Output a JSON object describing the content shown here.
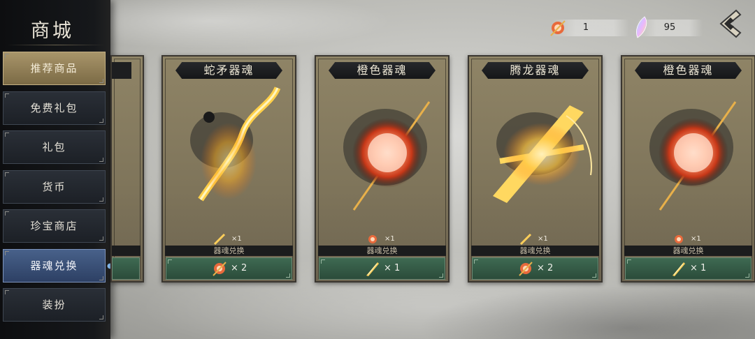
{
  "sidebar": {
    "title": "商城",
    "items": [
      {
        "label": "推荐商品",
        "state": "active-gold"
      },
      {
        "label": "免费礼包",
        "state": ""
      },
      {
        "label": "礼包",
        "state": ""
      },
      {
        "label": "货币",
        "state": ""
      },
      {
        "label": "珍宝商店",
        "state": ""
      },
      {
        "label": "器魂兑换",
        "state": "active-blue"
      },
      {
        "label": "装扮",
        "state": ""
      }
    ]
  },
  "currencies": [
    {
      "icon": "soul-orb-icon",
      "value": "1"
    },
    {
      "icon": "crystal-feather-icon",
      "value": "95"
    }
  ],
  "back_icon": "back-arrow-icon",
  "cards": [
    {
      "title": "蛇矛器魂",
      "art": "serpent-spear-icon",
      "owned": "×1",
      "owned_icon": "blade-shard-icon",
      "exchange_label": "器魂兑换",
      "cost_icon": "soul-orb-icon",
      "cost": "× 2"
    },
    {
      "title": "橙色器魂",
      "art": "orange-soul-orb-icon",
      "owned": "×1",
      "owned_icon": "soul-orb-icon",
      "exchange_label": "器魂兑换",
      "cost_icon": "blade-shard-icon",
      "cost": "× 1"
    },
    {
      "title": "腾龙器魂",
      "art": "dragon-crossbow-icon",
      "owned": "×1",
      "owned_icon": "blade-shard-icon",
      "exchange_label": "器魂兑换",
      "cost_icon": "soul-orb-icon",
      "cost": "× 2"
    },
    {
      "title": "橙色器魂",
      "art": "orange-soul-orb-icon",
      "owned": "×1",
      "owned_icon": "soul-orb-icon",
      "exchange_label": "器魂兑换",
      "cost_icon": "blade-shard-icon",
      "cost": "× 1"
    }
  ]
}
